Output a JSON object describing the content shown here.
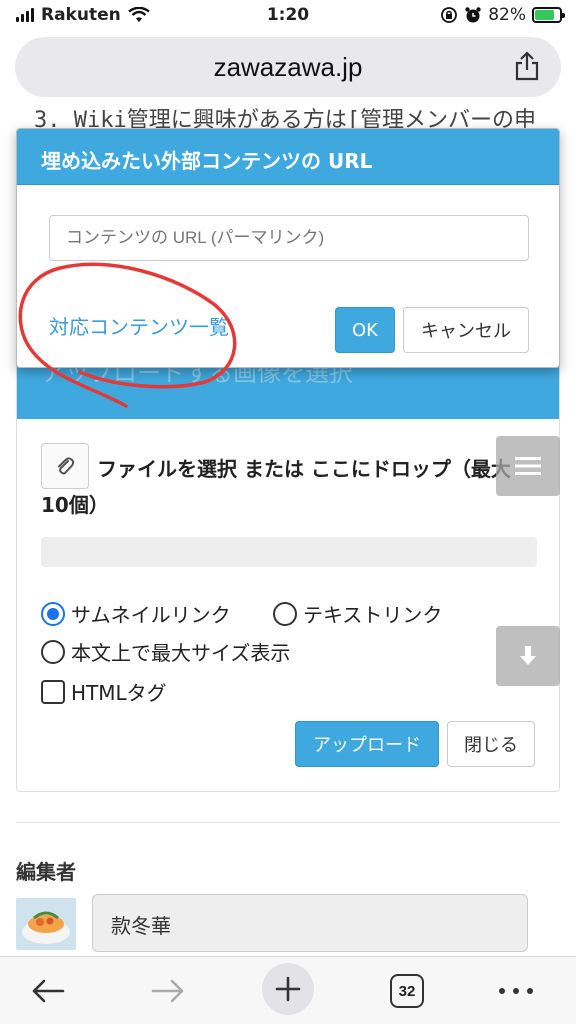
{
  "status_bar": {
    "carrier": "Rakuten",
    "time": "1:20",
    "battery": "82%"
  },
  "browser": {
    "domain": "zawazawa.jp",
    "tab_count": "32"
  },
  "page": {
    "background_line": "3. Wiki管理に興味がある方は[管理メンバーの申",
    "upload_header_ghost": "アップロードする画像を選択",
    "file_label": "ファイルを選択 または ここにドロップ（最大10個）",
    "options": {
      "thumbnail_link": "サムネイルリンク",
      "text_link": "テキストリンク",
      "max_size": "本文上で最大サイズ表示",
      "html_tag": "HTMLタグ"
    },
    "upload_button": "アップロード",
    "close_button": "閉じる",
    "editor_label": "編集者",
    "editor_name": "款冬華"
  },
  "modal": {
    "title": "埋め込みたい外部コンテンツの URL",
    "input_placeholder": "コンテンツの URL (パーマリンク)",
    "supported_link": "対応コンテンツ一覧",
    "ok_button": "OK",
    "cancel_button": "キャンセル"
  },
  "colors": {
    "accent": "#3fa9df",
    "link": "#3a9ad9",
    "annotation": "#e53935"
  }
}
